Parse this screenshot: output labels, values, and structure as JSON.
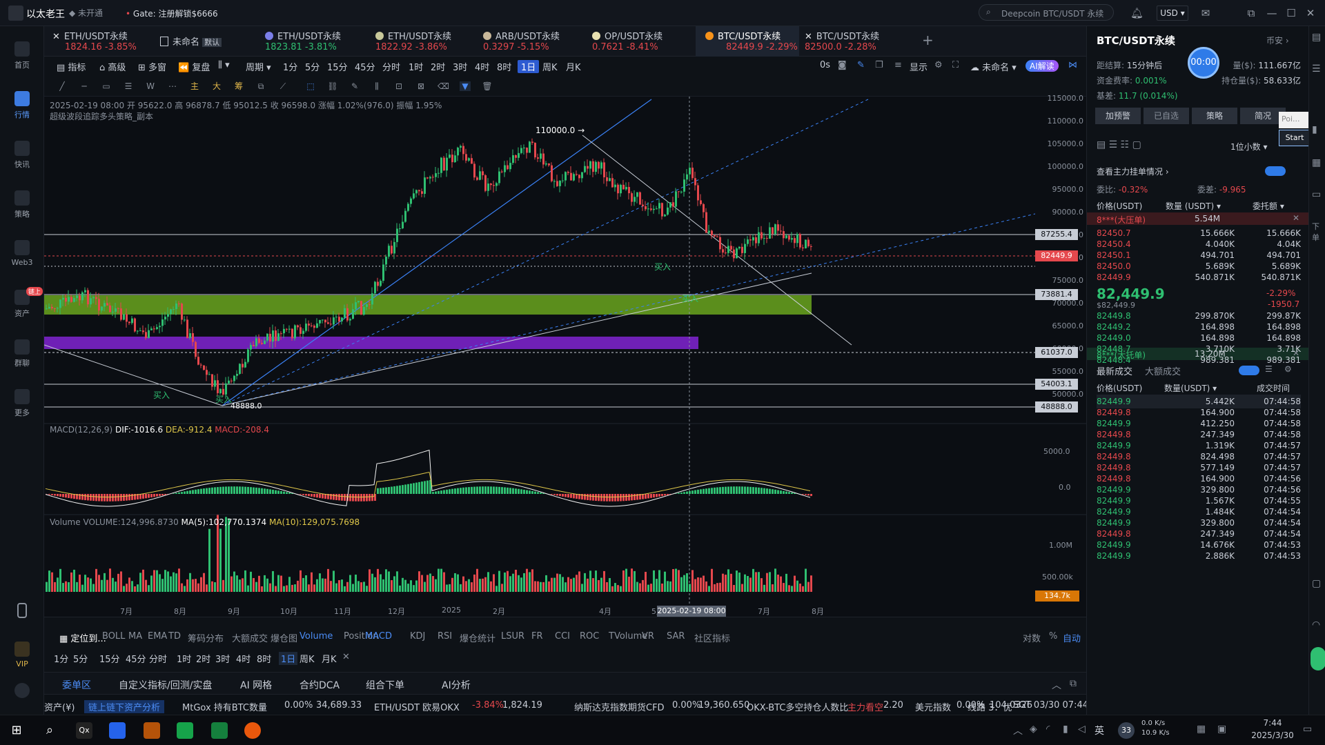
{
  "titlebar": {
    "app_name": "以太老王",
    "status_badge": "未开通",
    "promo": "Gate: 注册解锁$6666",
    "search_placeholder": "Deepcoin BTC/USDT 永续",
    "currency": "USD"
  },
  "sidebar": {
    "items": [
      {
        "label": "首页"
      },
      {
        "label": "行情"
      },
      {
        "label": "快讯"
      },
      {
        "label": "策略"
      },
      {
        "label": "Web3"
      },
      {
        "label": "资产"
      },
      {
        "label": "群聊"
      },
      {
        "label": "更多"
      },
      {
        "label": "VIP"
      }
    ],
    "badge": "链上"
  },
  "tabs": [
    {
      "name": "ETH/USDT永续",
      "price": "1824.16",
      "change": "-3.85%",
      "dir": "down",
      "icon": "close"
    },
    {
      "name": "未命名",
      "tag": "默认",
      "price": "",
      "change": "",
      "dir": "none",
      "icon": "layout"
    },
    {
      "name": "ETH/USDT永续",
      "price": "1823.81",
      "change": "-3.81%",
      "dir": "up",
      "icon": "coin"
    },
    {
      "name": "ETH/USDT永续",
      "price": "1822.92",
      "change": "-3.86%",
      "dir": "down",
      "icon": "coin"
    },
    {
      "name": "ARB/USDT永续",
      "price": "0.3297",
      "change": "-5.15%",
      "dir": "down",
      "icon": "coin"
    },
    {
      "name": "OP/USDT永续",
      "price": "0.7621",
      "change": "-8.41%",
      "dir": "down",
      "icon": "coin"
    },
    {
      "name": "BTC/USDT永续",
      "price": "82449.9",
      "change": "-2.29%",
      "dir": "down",
      "icon": "btc"
    },
    {
      "name": "BTC/USDT永续",
      "price": "82500.0",
      "change": "-2.28%",
      "dir": "down",
      "icon": "close"
    }
  ],
  "toolbar1": {
    "items": [
      "指标",
      "高级",
      "多窗",
      "复盘",
      "周期",
      "1分",
      "5分",
      "15分",
      "45分",
      "分时",
      "1时",
      "2时",
      "3时",
      "4时",
      "8时",
      "1日",
      "周K",
      "月K"
    ],
    "active": "1日",
    "right": [
      "0s",
      "显示",
      "未命名",
      "AI解读"
    ]
  },
  "chart": {
    "info_line": "2025-02-19 08:00  开 95622.0  高 96878.7  低 95012.5  收 96598.0  涨幅 1.02%(976.0)  振幅 1.95%",
    "strategy_line": "超级波段追踪多头策略_副本",
    "price_axis": [
      "115000.0",
      "110000.0",
      "105000.0",
      "100000.0",
      "95000.0",
      "90000.0",
      "85000.0",
      "80000.0",
      "75000.0",
      "70000.0",
      "65000.0",
      "60000.0",
      "55000.0",
      "50000.0"
    ],
    "level_labels": [
      "87255.4",
      "82449.9",
      "73881.4",
      "61037.0",
      "54003.1",
      "48888.0"
    ],
    "peak_label": "110000.0 →",
    "low_label": "48888.0",
    "buy_label": "买入",
    "time_axis": [
      "7月",
      "8月",
      "9月",
      "10月",
      "11月",
      "12月",
      "2025",
      "2月",
      "4月",
      "5月",
      "6月",
      "7月",
      "8月"
    ],
    "crosshair_time": "2025-02-19 08:00",
    "macd_line": "MACD(12,26,9)",
    "macd_dif": "DIF:-1016.6",
    "macd_dea": "DEA:-912.4",
    "macd_val": "MACD:-208.4",
    "macd_axis": [
      "5000.0",
      "0.0"
    ],
    "vol_line": "Volume  VOLUME:124,996.8730",
    "vol_ma5": "MA(5):102,770.1374",
    "vol_ma10": "MA(10):129,075.7698",
    "vol_axis": [
      "1.00M",
      "500.00k"
    ],
    "vol_current": "134.7k",
    "colors": {
      "up": "#2fbf71",
      "down": "#e5484d",
      "green_zone": "#6aa51e",
      "purple_zone": "#8a2be2",
      "trend": "#3b82f6"
    }
  },
  "bottom": {
    "locate": "定位到...",
    "indicators": [
      "BOLL",
      "MA",
      "EMA",
      "TD",
      "筹码分布",
      "大额成交",
      "爆仓图",
      "Volume",
      "Position",
      "MACD",
      "KDJ",
      "RSI",
      "爆仓统计",
      "LSUR",
      "FR",
      "CCI",
      "ROC",
      "TVolume",
      "VR",
      "SAR",
      "社区指标"
    ],
    "active_indicators": [
      "Volume",
      "MACD"
    ],
    "right": [
      "对数",
      "%",
      "自动"
    ],
    "periods": [
      "1分",
      "5分",
      "15分",
      "45分",
      "分时",
      "1时",
      "2时",
      "3时",
      "4时",
      "8时",
      "1日",
      "周K",
      "月K"
    ],
    "active_period": "1日"
  },
  "panel_tabs": [
    "委单区",
    "自定义指标/回测/实盘",
    "AI 网格",
    "合约DCA",
    "组合下单",
    "AI分析"
  ],
  "ticker": {
    "items": [
      {
        "text": "资产(¥)",
        "c": "wht"
      },
      {
        "text": "链上链下资产分析",
        "c": "blue"
      },
      {
        "text": "MtGox 持有BTC数量",
        "c": "wht"
      },
      {
        "text": "0.00%",
        "c": "wht"
      },
      {
        "text": "34,689.33",
        "c": "wht"
      },
      {
        "text": "ETH/USDT 欧易OKX",
        "c": "wht"
      },
      {
        "text": "-3.84%",
        "c": "red"
      },
      {
        "text": "1,824.19",
        "c": "wht"
      },
      {
        "text": "纳斯达克指数期货CFD",
        "c": "wht"
      },
      {
        "text": "0.00%",
        "c": "wht"
      },
      {
        "text": "19,360.650",
        "c": "wht"
      },
      {
        "text": "OKX-BTC多空持仓人数比",
        "c": "wht"
      },
      {
        "text": "主力看空",
        "c": "red"
      },
      {
        "text": "2.20",
        "c": "wht"
      },
      {
        "text": "美元指数",
        "c": "wht"
      },
      {
        "text": "0.00%",
        "c": "wht"
      },
      {
        "text": "104.0326",
        "c": "wht"
      }
    ],
    "line": "线路 3：优",
    "time": "SGT 03/30 07:44:58"
  },
  "right": {
    "symbol": "BTC/USDT永续",
    "exchange": "币安",
    "settle_label": "距结算:",
    "settle_val": "15分钟后",
    "funding_label": "资金费率:",
    "funding_val": "0.001%",
    "basis_label": "基差:",
    "basis_val": "11.7 (0.014%)",
    "vol_label": "量($):",
    "vol_val": "111.667亿",
    "oi_label": "持仓量($):",
    "oi_val": "58.633亿",
    "timer": "00:00",
    "buttons": [
      "加预警",
      "已自选",
      "策略",
      "简况"
    ],
    "popup_input": "Poi...",
    "popup_button": "Start",
    "precision": "1位小数",
    "main_orders": "查看主力挂单情况",
    "ratio_label": "委比:",
    "ratio_val": "-0.32%",
    "diff_label": "委差:",
    "diff_val": "-9.965",
    "head": [
      "价格(USDT)",
      "数量 (USDT)",
      "委托额"
    ],
    "big_ask": {
      "label": "8***(大压单)",
      "val": "5.54M"
    },
    "asks": [
      [
        "82450.7",
        "15.666K",
        "15.666K"
      ],
      [
        "82450.4",
        "4.040K",
        "4.04K"
      ],
      [
        "82450.1",
        "494.701",
        "494.701"
      ],
      [
        "82450.0",
        "5.689K",
        "5.689K"
      ],
      [
        "82449.9",
        "540.871K",
        "540.871K"
      ]
    ],
    "last_price": "82,449.9",
    "last_sub": "$82,449.9",
    "change_pct": "-2.29%",
    "change_val": "-1950.7",
    "bids": [
      [
        "82449.8",
        "299.870K",
        "299.87K"
      ],
      [
        "82449.2",
        "164.898",
        "164.898"
      ],
      [
        "82449.0",
        "164.898",
        "164.898"
      ],
      [
        "82448.7",
        "3.710K",
        "3.71K"
      ],
      [
        "82448.4",
        "989.381",
        "989.381"
      ]
    ],
    "big_bid": {
      "label": "8***(大托单)",
      "val": "13.20M"
    },
    "trades_tabs": [
      "最新成交",
      "大额成交"
    ],
    "trades_head": [
      "价格(USDT)",
      "数量(USDT)",
      "成交时间"
    ],
    "trades": [
      [
        "82449.9",
        "5.442K",
        "07:44:58",
        "g"
      ],
      [
        "82449.8",
        "164.900",
        "07:44:58",
        "r"
      ],
      [
        "82449.9",
        "412.250",
        "07:44:58",
        "g"
      ],
      [
        "82449.8",
        "247.349",
        "07:44:58",
        "r"
      ],
      [
        "82449.9",
        "1.319K",
        "07:44:57",
        "g"
      ],
      [
        "82449.8",
        "824.498",
        "07:44:57",
        "r"
      ],
      [
        "82449.8",
        "577.149",
        "07:44:57",
        "r"
      ],
      [
        "82449.8",
        "164.900",
        "07:44:56",
        "r"
      ],
      [
        "82449.9",
        "329.800",
        "07:44:56",
        "g"
      ],
      [
        "82449.9",
        "1.567K",
        "07:44:55",
        "g"
      ],
      [
        "82449.9",
        "1.484K",
        "07:44:54",
        "g"
      ],
      [
        "82449.9",
        "329.800",
        "07:44:54",
        "g"
      ],
      [
        "82449.8",
        "247.349",
        "07:44:54",
        "r"
      ],
      [
        "82449.9",
        "14.676K",
        "07:44:53",
        "g"
      ],
      [
        "82449.9",
        "2.886K",
        "07:44:53",
        "g"
      ]
    ]
  },
  "taskbar": {
    "ime": "英",
    "temp": "33",
    "net_up": "0.0 K/s",
    "net_down": "10.9 K/s",
    "time": "7:44",
    "date": "2025/3/30"
  }
}
